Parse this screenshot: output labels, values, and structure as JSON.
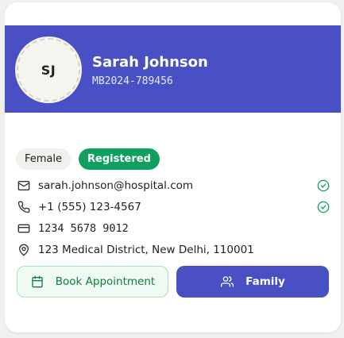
{
  "patient": {
    "initials": "SJ",
    "name": "Sarah Johnson",
    "mrn": "MB2024-789456"
  },
  "badges": {
    "gender": "Female",
    "status": "Registered"
  },
  "contact": {
    "email": "sarah.johnson@hospital.com",
    "phone": "+1 (555) 123-4567",
    "card": "1234 5678 9012",
    "address": "123 Medical District, New Delhi, 110001"
  },
  "actions": {
    "book_label": "Book Appointment",
    "family_label": "Family"
  },
  "colors": {
    "header": "#4850c4",
    "status": "#0f9f5e",
    "verified": "#19a35a",
    "book_bg": "#effaf2",
    "book_text": "#157a43"
  },
  "icons": {
    "email": "mail-icon",
    "phone": "phone-icon",
    "card": "credit-card-icon",
    "address": "map-pin-icon",
    "verified": "check-circle-icon",
    "book": "calendar-icon",
    "family": "users-icon"
  }
}
